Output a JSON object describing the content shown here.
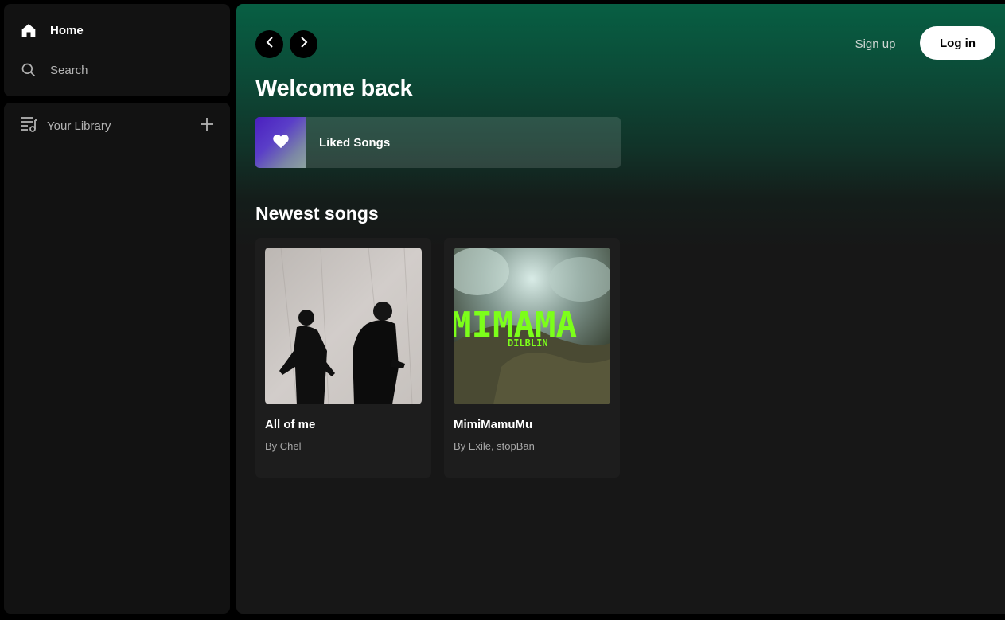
{
  "sidebar": {
    "nav": [
      {
        "label": "Home",
        "icon": "home-icon"
      },
      {
        "label": "Search",
        "icon": "search-icon"
      }
    ],
    "library": {
      "label": "Your Library",
      "icon": "library-icon",
      "add_icon": "plus-icon"
    }
  },
  "header": {
    "signup_label": "Sign up",
    "login_label": "Log in"
  },
  "main": {
    "greeting": "Welcome back",
    "liked": {
      "label": "Liked Songs",
      "icon": "heart-icon"
    },
    "section_title": "Newest songs",
    "cards": [
      {
        "title": "All of me",
        "subtitle": "By Chel"
      },
      {
        "title": "MimiMamuMu",
        "subtitle": "By Exile, stopBan",
        "cover_text": "MIMAMA",
        "cover_subtext": "DILBLIN"
      }
    ]
  },
  "colors": {
    "accent_green": "#075f43",
    "cover_text_green": "#7cff1a"
  }
}
